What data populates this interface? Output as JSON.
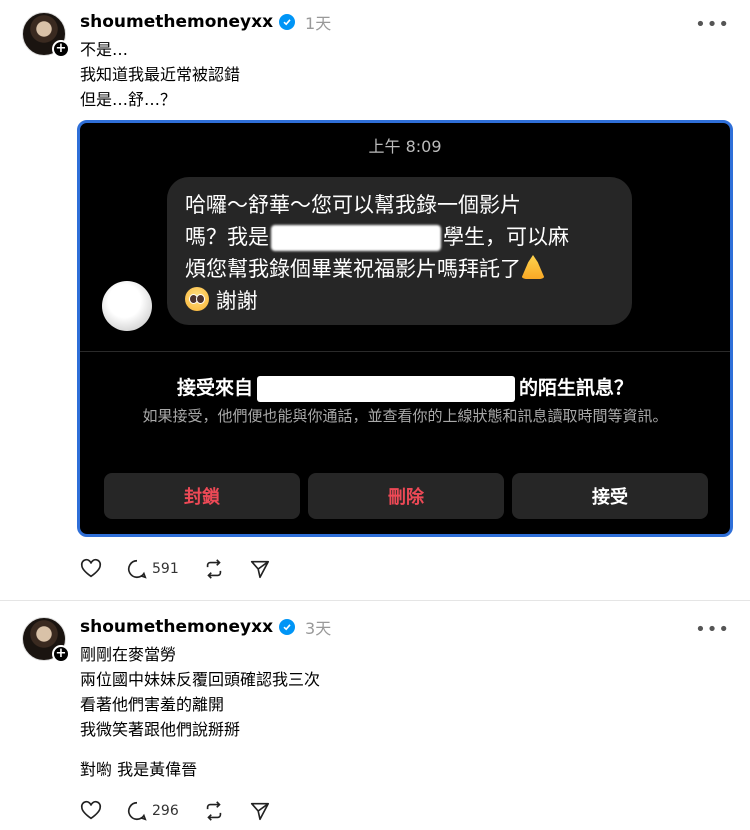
{
  "posts": [
    {
      "username": "shoumethemoneyxx",
      "time": "1天",
      "lines": [
        "不是…",
        "我知道我最近常被認錯",
        "但是…舒…？"
      ],
      "embed": {
        "time": "上午 8:09",
        "message_lines": [
          "哈囉～舒華～您可以幫我錄一個影片",
          "嗎？我是",
          "學生，可以麻",
          "煩您幫我錄個畢業祝福影片嗎拜託了",
          "謝謝"
        ],
        "request_prefix": "接受來自",
        "request_suffix": "的陌生訊息？",
        "request_desc": "如果接受，他們便也能與你通話，並查看你的上線狀態和訊息讀取時間等資訊。",
        "buttons": {
          "block": "封鎖",
          "delete": "刪除",
          "accept": "接受"
        }
      },
      "reply_count": "591"
    },
    {
      "username": "shoumethemoneyxx",
      "time": "3天",
      "lines": [
        "剛剛在麥當勞",
        "兩位國中妹妹反覆回頭確認我三次",
        "看著他們害羞的離開",
        "我微笑著跟他們說掰掰"
      ],
      "closing_line": "對喲 我是黃偉晉",
      "reply_count": "296"
    }
  ],
  "colors": {
    "verified": "#0095f6",
    "danger": "#ed4956",
    "frame": "#2f6fd8"
  }
}
